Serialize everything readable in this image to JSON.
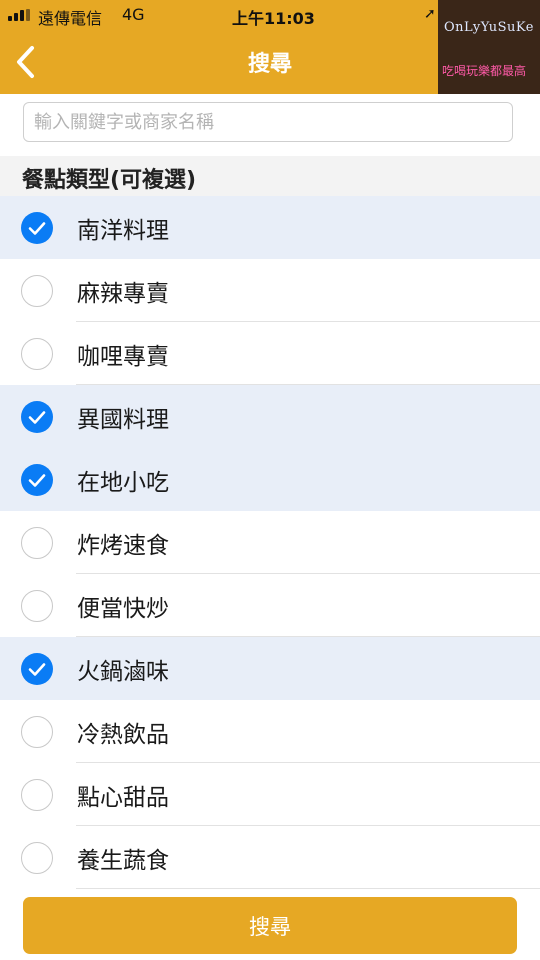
{
  "status_bar": {
    "carrier": "遠傳電信",
    "network": "4G",
    "time": "上午11:03",
    "signal_bars": 3
  },
  "navbar": {
    "back_icon": "chevron-left-icon",
    "title": "搜尋"
  },
  "watermark": {
    "title": "OnLyYuSuKe",
    "subtitle": "吃喝玩樂都最高"
  },
  "search": {
    "placeholder": "輸入關鍵字或商家名稱",
    "value": ""
  },
  "section": {
    "title": "餐點類型(可複選)"
  },
  "categories": [
    {
      "label": "南洋料理",
      "checked": true
    },
    {
      "label": "麻辣專賣",
      "checked": false
    },
    {
      "label": "咖哩專賣",
      "checked": false
    },
    {
      "label": "異國料理",
      "checked": true
    },
    {
      "label": "在地小吃",
      "checked": true
    },
    {
      "label": "炸烤速食",
      "checked": false
    },
    {
      "label": "便當快炒",
      "checked": false
    },
    {
      "label": "火鍋滷味",
      "checked": true
    },
    {
      "label": "冷熱飲品",
      "checked": false
    },
    {
      "label": "點心甜品",
      "checked": false
    },
    {
      "label": "養生蔬食",
      "checked": false
    }
  ],
  "submit_button": {
    "label": "搜尋"
  },
  "colors": {
    "brand": "#e6a824",
    "check_blue": "#0a7cf5",
    "selected_row": "#e8eef8"
  }
}
